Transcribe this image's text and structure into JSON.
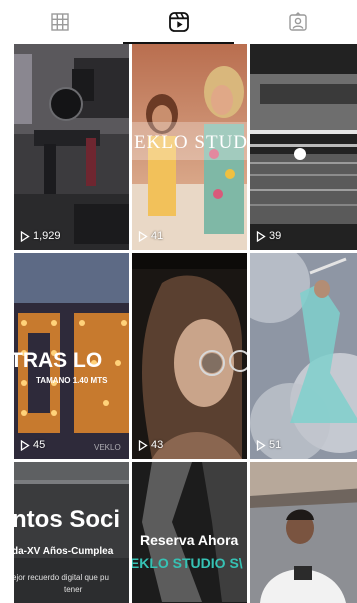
{
  "tabs": [
    {
      "icon": "grid-icon",
      "active": false
    },
    {
      "icon": "reels-icon",
      "active": true
    },
    {
      "icon": "tagged-icon",
      "active": false
    }
  ],
  "reels": [
    {
      "views": "1,929"
    },
    {
      "views": "41",
      "overlay": "EKLO STUDIO S"
    },
    {
      "views": "39"
    },
    {
      "views": "45",
      "overlay": "TRAS LO",
      "overlay2": "TAMANO 1.40 MTS",
      "overlay3": "VEKLO"
    },
    {
      "views": "43"
    },
    {
      "views": "51"
    },
    {
      "overlay": "ntos Soci",
      "overlay2": "da-XV Años-Cumplea",
      "overlay3": "ejor recuerdo digital que pu",
      "overlay4": "tener"
    },
    {
      "overlay": "Reserva Ahora",
      "overlay2": "/EKLO STUDIO S\\"
    },
    {}
  ]
}
